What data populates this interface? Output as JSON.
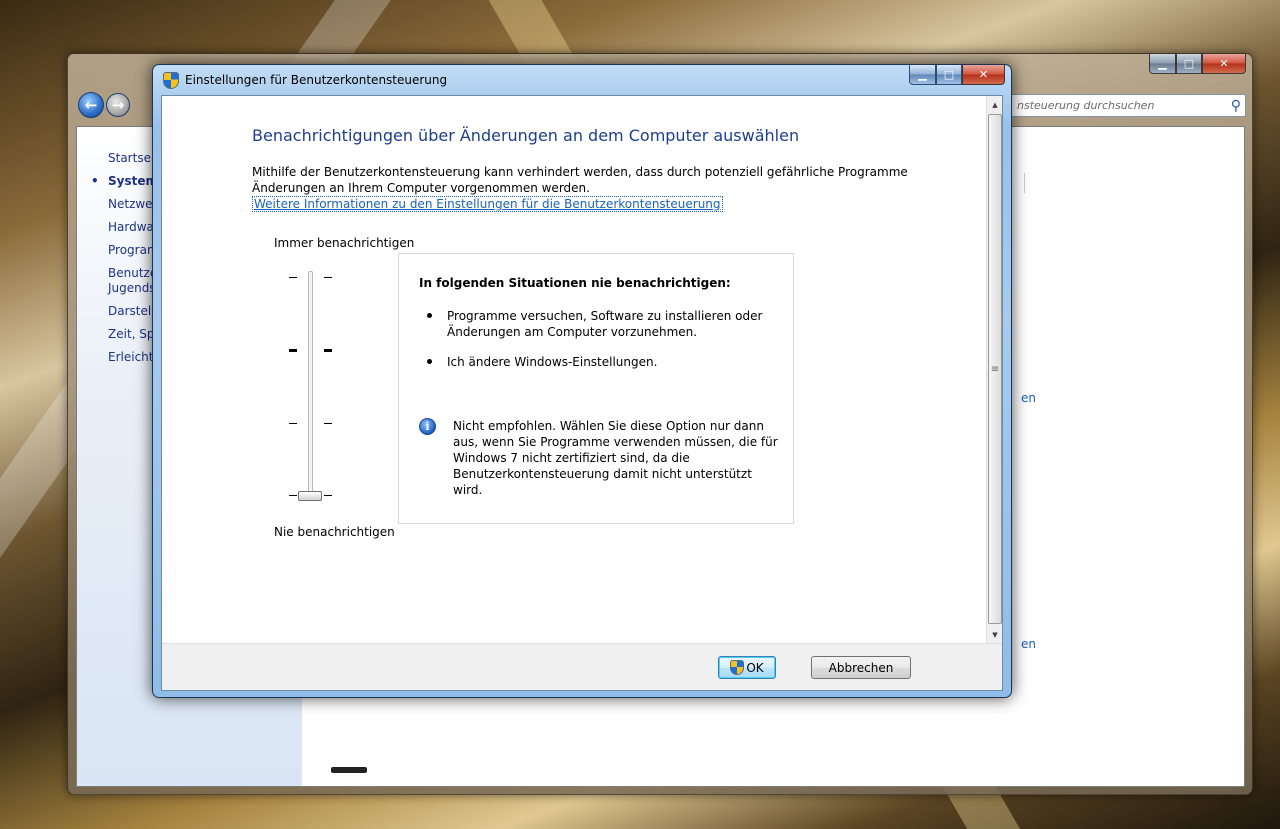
{
  "background_window": {
    "search_placeholder": "nsteuerung durchsuchen",
    "sidebar_items": [
      "Startseite",
      "System",
      "Netzwe",
      "Hardwa",
      "Program",
      "Benutze Jugends",
      "Darstell",
      "Zeit, Sp",
      "Erleicht"
    ],
    "partial_link_1": "en",
    "partial_link_2": "en"
  },
  "dialog": {
    "title": "Einstellungen für Benutzerkontensteuerung",
    "heading": "Benachrichtigungen über Änderungen an dem Computer auswählen",
    "description": "Mithilfe der Benutzerkontensteuerung kann verhindert werden, dass durch potenziell gefährliche Programme Änderungen an Ihrem Computer vorgenommen werden.",
    "more_info_link": "Weitere Informationen zu den Einstellungen für die Benutzerkontensteuerung",
    "slider": {
      "top_label": "Immer benachrichtigen",
      "bottom_label": "Nie benachrichtigen",
      "levels": 4,
      "selected_level": 1
    },
    "info": {
      "title": "In folgenden Situationen nie benachrichtigen:",
      "bullets": [
        "Programme versuchen, Software zu installieren oder Änderungen am Computer vorzunehmen.",
        "Ich ändere Windows-Einstellungen."
      ],
      "note": "Nicht empfohlen. Wählen Sie diese Option nur dann aus, wenn Sie Programme verwenden müssen, die für Windows 7 nicht zertifiziert sind, da die Benutzerkontensteuerung damit nicht unterstützt wird."
    },
    "buttons": {
      "ok": "OK",
      "cancel": "Abbrechen"
    }
  },
  "colors": {
    "heading": "#1e3e8c",
    "link": "#1a62b8",
    "close_button": "#c6402a"
  }
}
